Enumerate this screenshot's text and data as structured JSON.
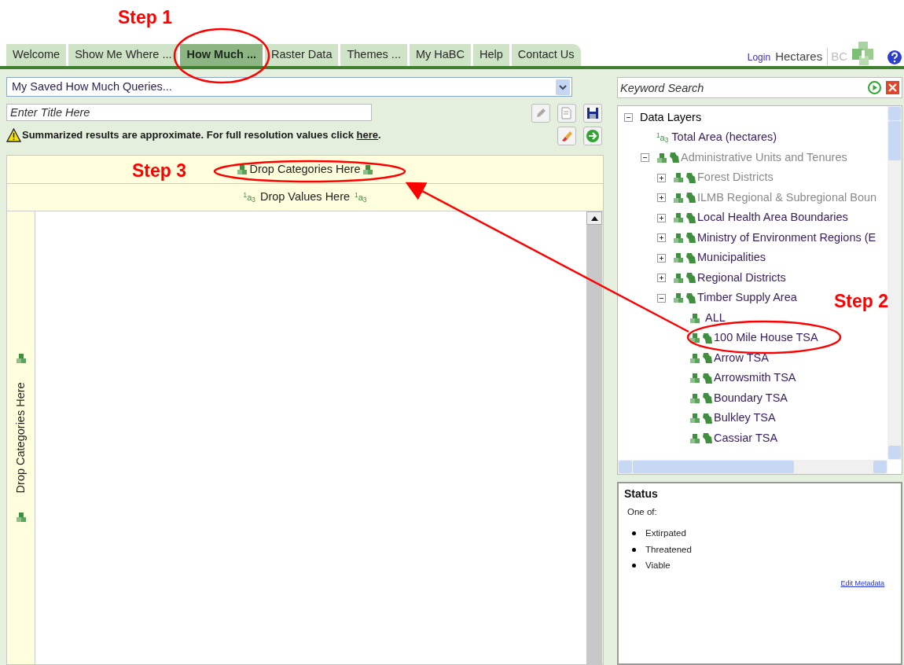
{
  "annotations": [
    {
      "kind": "label",
      "text": "Step 1"
    },
    {
      "kind": "label",
      "text": "Step 3"
    },
    {
      "kind": "label",
      "text": "Step 2"
    }
  ],
  "tabs": [
    {
      "label": "Welcome",
      "selected": false
    },
    {
      "label": "Show Me Where ...",
      "selected": false
    },
    {
      "label": "How Much ...",
      "selected": true
    },
    {
      "label": "Raster Data",
      "selected": false
    },
    {
      "label": "Themes ...",
      "selected": false
    },
    {
      "label": "My HaBC",
      "selected": false
    },
    {
      "label": "Help",
      "selected": false
    },
    {
      "label": "Contact Us",
      "selected": false
    }
  ],
  "header": {
    "login": "Login",
    "logo_main": "Hectares",
    "logo_sub": "BC"
  },
  "query_select": {
    "value": "My Saved How Much Queries..."
  },
  "title_field": {
    "placeholder": "Enter Title Here"
  },
  "notice": {
    "text": "Summarized results are approximate. For full resolution values click",
    "link": "here",
    "tail": "."
  },
  "pivot": {
    "category_drop": "Drop Categories Here",
    "value_drop": {
      "icon_left": "$^{1}$a$_{3}$",
      "label": "Drop Values Here",
      "icon_right": "$^{1}$a$_{3}$"
    },
    "row_drop": "Drop Categories Here"
  },
  "keyword_search": {
    "placeholder": "Keyword Search"
  },
  "tree": [
    {
      "label": "Data Layers",
      "kind": "root",
      "expanded": true,
      "greyed": false,
      "children": [
        {
          "label": "Total Area (hectares)",
          "kind": "value",
          "icon_text": "$^{1}$a$_{3}$",
          "greyed": false
        },
        {
          "label": "Administrative Units and Tenures",
          "kind": "category",
          "expanded": true,
          "greyed": true,
          "children": [
            {
              "label": "Forest Districts",
              "kind": "category",
              "expanded": false,
              "greyed": true
            },
            {
              "label": "ILMB Regional & Subregional Boun",
              "kind": "category",
              "expanded": false,
              "greyed": true
            },
            {
              "label": "Local Health Area Boundaries",
              "kind": "category",
              "expanded": false,
              "greyed": false
            },
            {
              "label": "Ministry of Environment Regions (E",
              "kind": "category",
              "expanded": false,
              "greyed": false
            },
            {
              "label": "Municipalities",
              "kind": "category",
              "expanded": false,
              "greyed": false
            },
            {
              "label": "Regional Districts",
              "kind": "category",
              "expanded": false,
              "greyed": false
            },
            {
              "label": "Timber Supply Area",
              "kind": "category",
              "expanded": true,
              "greyed": false,
              "children": [
                {
                  "label": "ALL",
                  "kind": "all",
                  "greyed": false
                },
                {
                  "label": "100 Mile House TSA",
                  "kind": "member",
                  "greyed": false
                },
                {
                  "label": "Arrow TSA",
                  "kind": "member",
                  "greyed": false
                },
                {
                  "label": "Arrowsmith TSA",
                  "kind": "member",
                  "greyed": false
                },
                {
                  "label": "Boundary TSA",
                  "kind": "member",
                  "greyed": false
                },
                {
                  "label": "Bulkley TSA",
                  "kind": "member",
                  "greyed": false
                },
                {
                  "label": "Cassiar TSA",
                  "kind": "member",
                  "greyed": false
                }
              ]
            }
          ]
        }
      ]
    }
  ],
  "metadata": {
    "title": "Status",
    "intro": "One of:",
    "items": [
      "Extirpated",
      "Threatened",
      "Viable"
    ],
    "link": "Edit Metadata"
  }
}
